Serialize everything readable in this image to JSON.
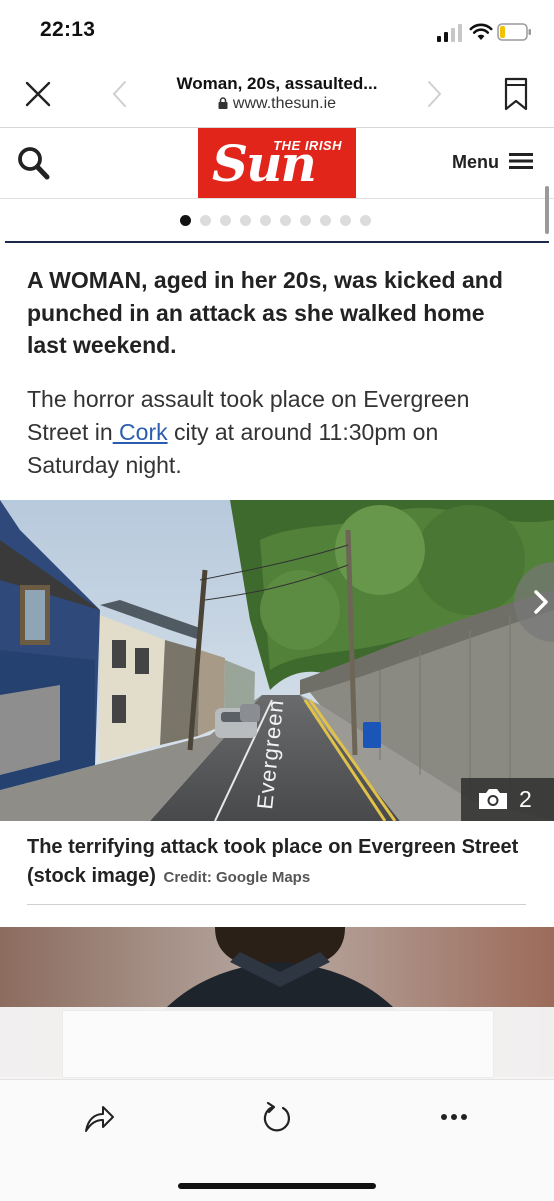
{
  "status_bar": {
    "time": "22:13"
  },
  "browser": {
    "page_title": "Woman, 20s, assaulted...",
    "url": "www.thesun.ie"
  },
  "site_header": {
    "logo_top": "THE IRISH",
    "logo_main": "Sun",
    "menu_label": "Menu"
  },
  "carousel": {
    "total_dots": 10,
    "active_index": 0
  },
  "article": {
    "lead": "A WOMAN, aged in her 20s, was kicked and punched in an attack as she walked home last weekend.",
    "para_before_link": "The horror assault took place on Evergreen Street in",
    "link_text": " Cork",
    "para_after_link": " city at around 11:30pm on Saturday night.",
    "photo": {
      "street_sign": "Evergreen",
      "gallery_count": "2"
    },
    "caption": "The terrifying attack took place on Evergreen Street (stock image)",
    "credit": "Credit: Google Maps"
  },
  "colors": {
    "brand_red": "#e1251b",
    "link_blue": "#2a5db0",
    "rule_navy": "#1b2a4a"
  },
  "icons": [
    "close-icon",
    "chevron-left-icon",
    "chevron-right-icon",
    "bookmark-icon",
    "lock-icon",
    "search-icon",
    "menu-icon",
    "camera-icon",
    "share-icon",
    "reload-icon",
    "more-icon"
  ]
}
